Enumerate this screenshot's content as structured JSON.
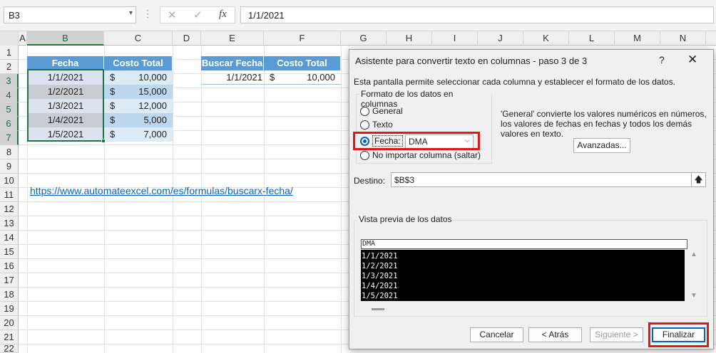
{
  "formula_bar": {
    "name_box": "B3",
    "name_box_arrow": "▾",
    "dots": "⋮",
    "cancel_glyph": "✕",
    "enter_glyph": "✓",
    "fx_glyph": "fx",
    "formula_value": "1/1/2021"
  },
  "columns": [
    "A",
    "B",
    "C",
    "D",
    "E",
    "F",
    "G",
    "H",
    "I",
    "J",
    "K",
    "L",
    "M",
    "N"
  ],
  "rows": [
    "1",
    "2",
    "3",
    "4",
    "5",
    "6",
    "7",
    "8",
    "9",
    "10",
    "11",
    "12",
    "13",
    "14",
    "15",
    "16",
    "17",
    "18",
    "19",
    "20",
    "21",
    "22"
  ],
  "table1": {
    "header_fecha": "Fecha",
    "header_costo": "Costo Total",
    "rows": [
      {
        "fecha": "1/1/2021",
        "currency": "$",
        "costo": "10,000"
      },
      {
        "fecha": "1/2/2021",
        "currency": "$",
        "costo": "15,000"
      },
      {
        "fecha": "1/3/2021",
        "currency": "$",
        "costo": "12,000"
      },
      {
        "fecha": "1/4/2021",
        "currency": "$",
        "costo": "5,000"
      },
      {
        "fecha": "1/5/2021",
        "currency": "$",
        "costo": "7,000"
      }
    ]
  },
  "table2": {
    "header_buscar": "Buscar Fecha",
    "header_costo": "Costo Total",
    "fecha": "1/1/2021",
    "currency": "$",
    "costo": "10,000"
  },
  "link": "https://www.automateexcel.com/es/formulas/buscarx-fecha/",
  "dialog": {
    "title": "Asistente para convertir texto en columnas - paso 3 de 3",
    "help": "?",
    "close": "✕",
    "description": "Esta pantalla permite seleccionar cada columna y establecer el formato de los datos.",
    "format_legend": "Formato de los datos en columnas",
    "options": {
      "general": "General",
      "texto": "Texto",
      "fecha": "Fecha:",
      "no_importar": "No importar columna (saltar)"
    },
    "selected_option": "fecha",
    "date_format": "DMA",
    "select_arrow": "⌵",
    "general_desc": "'General' convierte los valores numéricos en números, los valores de fechas en fechas y todos los demás valores en texto.",
    "advanced_button": "Avanzadas...",
    "destino_label": "Destino:",
    "destino_value": "$B$3",
    "destino_button": "🡅",
    "preview_legend": "Vista previa de los datos",
    "preview_header": "DMA",
    "preview_rows": [
      "1/1/2021",
      "1/2/2021",
      "1/3/2021",
      "1/4/2021",
      "1/5/2021"
    ],
    "scroll_up": "▲",
    "scroll_down": "▼",
    "buttons": {
      "cancelar": "Cancelar",
      "atras": "< Atrás",
      "siguiente": "Siguiente >",
      "finalizar": "Finalizar"
    },
    "highlight_color": "#e01818",
    "accent_color": "#0067c0"
  }
}
